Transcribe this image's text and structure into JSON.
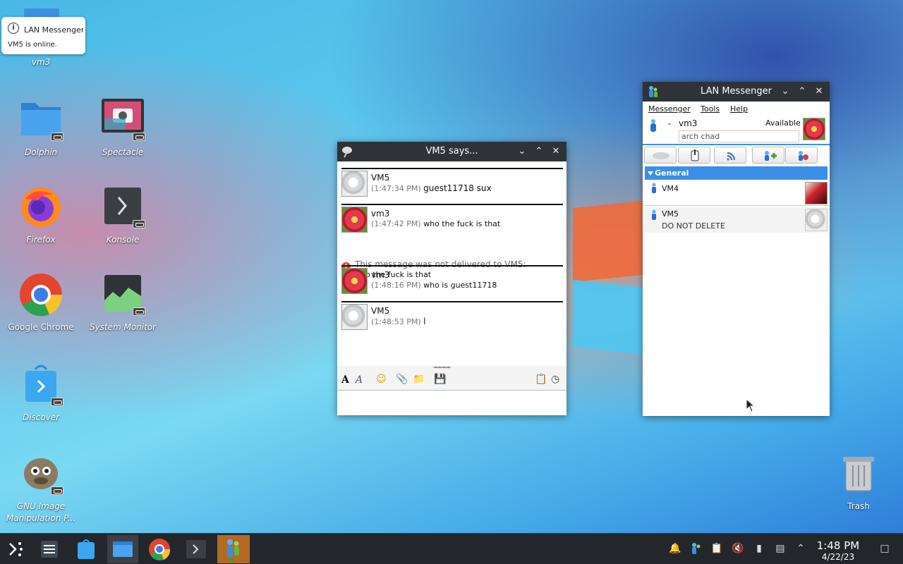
{
  "notification": {
    "title": "LAN Messenger",
    "body": "VM5 is online."
  },
  "desktop": {
    "icons": [
      {
        "label": "vm3"
      },
      {
        "label": "Dolphin"
      },
      {
        "label": "Spectacle"
      },
      {
        "label": "Firefox"
      },
      {
        "label": "Konsole"
      },
      {
        "label": "Google Chrome"
      },
      {
        "label": "System Monitor"
      },
      {
        "label": "Discover"
      },
      {
        "label": "GNU Image Manipulation P..."
      },
      {
        "label": "Trash"
      }
    ]
  },
  "chat": {
    "title": "VM5 says...",
    "messages": [
      {
        "name": "VM5",
        "time": "(1:47:34 PM)",
        "text": "guest11718 sux"
      },
      {
        "name": "vm3",
        "time": "(1:47:42 PM)",
        "text": "who the fuck is that"
      },
      {
        "name": "vm3",
        "time": "(1:48:16 PM)",
        "text": "who is guest11718"
      },
      {
        "name": "VM5",
        "time": "(1:48:53 PM)",
        "text": "l"
      }
    ],
    "warning": "This message was not delivered to VM5:",
    "warning_detail": "who the fuck is that",
    "handle": "''''''''''''''''''''",
    "input_value": ""
  },
  "messenger": {
    "title": "LAN Messenger",
    "menu": [
      "Messenger",
      "Tools",
      "Help"
    ],
    "user_name": "vm3",
    "status": "Available",
    "status_message": "arch chad",
    "group": "General",
    "contacts": [
      {
        "name": "VM4",
        "status": ""
      },
      {
        "name": "VM5",
        "status": "DO NOT DELETE"
      }
    ]
  },
  "taskbar": {
    "time": "1:48 PM",
    "date": "4/22/23"
  },
  "colors": {
    "accent": "#3d8ee6",
    "titlebar": "#2f3337",
    "taskbar": "#23262a",
    "error": "#e23b3b"
  }
}
